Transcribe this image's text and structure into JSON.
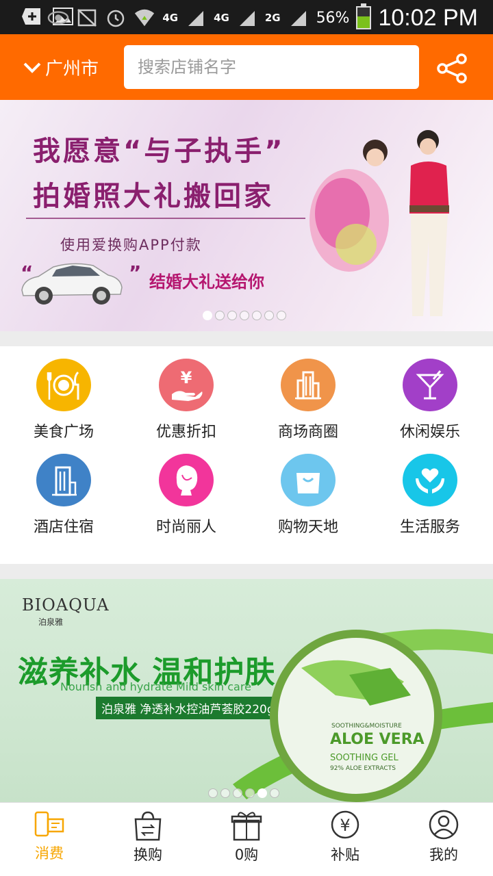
{
  "status_bar": {
    "network": [
      "4G",
      "4G",
      "2G"
    ],
    "battery": "56%",
    "battery_level": 0.56,
    "time": "10:02 PM"
  },
  "header": {
    "city": "广州市",
    "search_placeholder": "搜索店铺名字",
    "share_icon": "share-icon"
  },
  "banner_top": {
    "line1": "我愿意“与子执手”",
    "line2": "拍婚照大礼搬回家",
    "subline": "使用爱换购APP付款",
    "gift_text": "结婚大礼送给你",
    "slide_count": 7,
    "active_slide": 0
  },
  "categories": [
    {
      "label": "美食广场",
      "icon": "dining-icon",
      "color": "#f7b500"
    },
    {
      "label": "优惠折扣",
      "icon": "yen-hand-icon",
      "color": "#ee6b73"
    },
    {
      "label": "商场商圈",
      "icon": "mall-building-icon",
      "color": "#f0944a"
    },
    {
      "label": "休闲娱乐",
      "icon": "cocktail-icon",
      "color": "#a23fc8"
    },
    {
      "label": "酒店住宿",
      "icon": "hotel-building-icon",
      "color": "#3f82c7"
    },
    {
      "label": "时尚丽人",
      "icon": "woman-profile-icon",
      "color": "#f2359b"
    },
    {
      "label": "购物天地",
      "icon": "shopping-bag-icon",
      "color": "#6dc6ee"
    },
    {
      "label": "生活服务",
      "icon": "heart-hands-icon",
      "color": "#18c6e8"
    }
  ],
  "banner_ad": {
    "brand": "BIOAQUA",
    "brand_cn": "泊泉雅",
    "title": "滋养补水 温和护肤",
    "subtitle_en": "Nourish and hydrate Mild skin care",
    "product_tag": "泊泉雅 净透补水控油芦荟胶220g",
    "jar_text_1": "SOOTHING&MOISTURE",
    "jar_text_2": "ALOE VERA",
    "jar_text_3": "SOOTHING GEL",
    "jar_text_4": "92% ALOE EXTRACTS",
    "slide_count": 6,
    "active_slide": 4
  },
  "bottom_nav": [
    {
      "label": "消费",
      "icon": "phone-card-icon",
      "active": true
    },
    {
      "label": "换购",
      "icon": "exchange-bag-icon",
      "active": false
    },
    {
      "label": "0购",
      "icon": "gift-box-icon",
      "active": false
    },
    {
      "label": "补贴",
      "icon": "yen-circle-icon",
      "active": false
    },
    {
      "label": "我的",
      "icon": "user-circle-icon",
      "active": false
    }
  ],
  "colors": {
    "brand_orange": "#ff6a00",
    "active_tab": "#f7a600"
  }
}
